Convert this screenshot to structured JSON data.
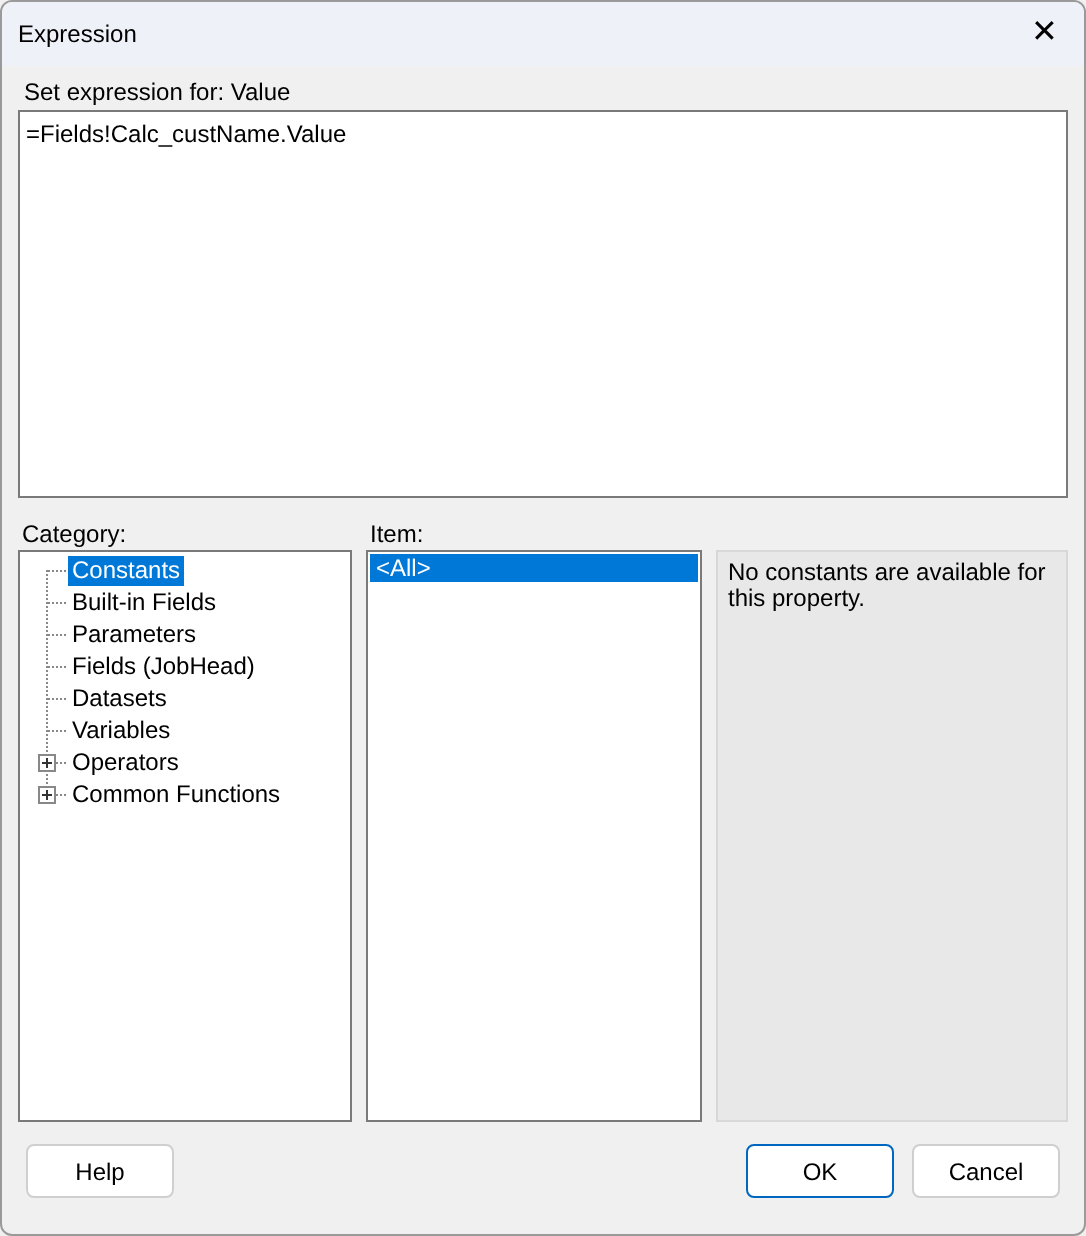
{
  "window": {
    "title": "Expression",
    "close": "✕"
  },
  "expression": {
    "label": "Set expression for: Value",
    "value": "=Fields!Calc_custName.Value"
  },
  "category": {
    "label": "Category:",
    "items": [
      {
        "label": "Constants",
        "selected": true,
        "kind": "leaf"
      },
      {
        "label": "Built-in Fields",
        "selected": false,
        "kind": "leaf"
      },
      {
        "label": "Parameters",
        "selected": false,
        "kind": "leaf"
      },
      {
        "label": "Fields (JobHead)",
        "selected": false,
        "kind": "leaf"
      },
      {
        "label": "Datasets",
        "selected": false,
        "kind": "leaf"
      },
      {
        "label": "Variables",
        "selected": false,
        "kind": "leaf"
      },
      {
        "label": "Operators",
        "selected": false,
        "kind": "folder",
        "expanded": false
      },
      {
        "label": "Common Functions",
        "selected": false,
        "kind": "folder",
        "expanded": false
      }
    ]
  },
  "item": {
    "label": "Item:",
    "items": [
      {
        "label": "<All>",
        "selected": true
      }
    ]
  },
  "description": "No constants are available for this property.",
  "buttons": [
    {
      "label": "Help",
      "kind": "normal"
    },
    {
      "label": "OK",
      "kind": "default"
    },
    {
      "label": "Cancel",
      "kind": "normal"
    }
  ]
}
